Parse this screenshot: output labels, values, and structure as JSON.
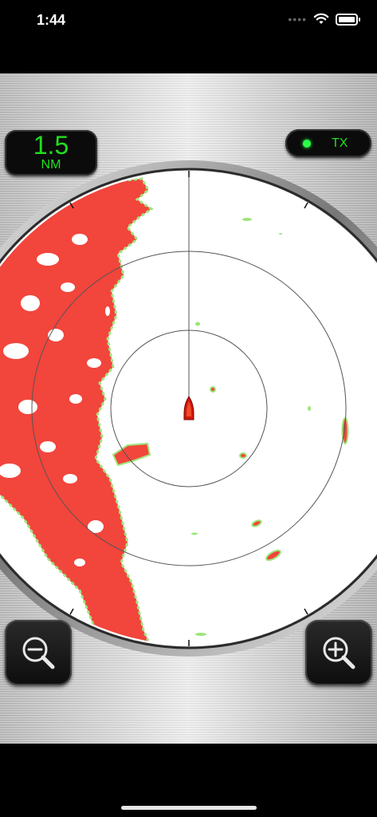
{
  "status_bar": {
    "time": "1:44"
  },
  "radar": {
    "range_value": "1.5",
    "range_unit": "NM",
    "tx_label": "TX"
  },
  "colors": {
    "echo": "#f2453c",
    "echo_edge": "#9ee57a",
    "display_text": "#1fe01f",
    "tx_led": "#2cff4a",
    "boat": "#d4140e"
  },
  "icons": {
    "zoom_out": "zoom-out-icon",
    "zoom_in": "zoom-in-icon",
    "boat": "boat-icon",
    "wifi": "wifi-icon",
    "battery": "battery-icon"
  }
}
